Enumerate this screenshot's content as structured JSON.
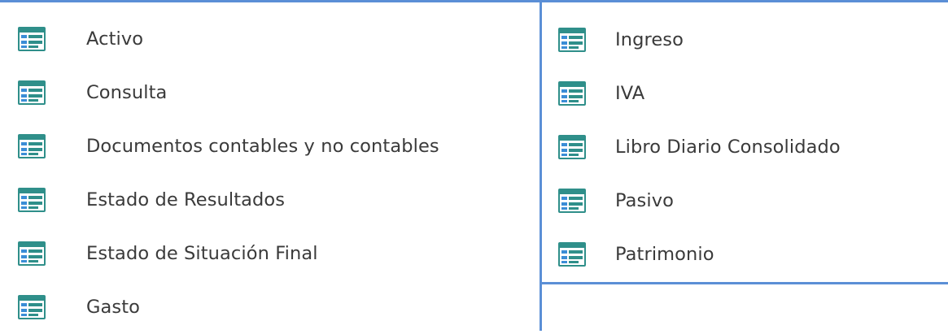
{
  "colors": {
    "border": "#5b8fd6",
    "text": "#3a3a3a",
    "icon_teal": "#2f8f8a",
    "icon_blue": "#4a7fc4"
  },
  "icon_name": "form-icon",
  "left_list": {
    "items": [
      {
        "label": "Activo"
      },
      {
        "label": "Consulta"
      },
      {
        "label": "Documentos contables y no contables"
      },
      {
        "label": "Estado de Resultados"
      },
      {
        "label": "Estado de Situación Final"
      },
      {
        "label": "Gasto"
      }
    ]
  },
  "right_list": {
    "items": [
      {
        "label": "Ingreso"
      },
      {
        "label": "IVA"
      },
      {
        "label": "Libro Diario Consolidado"
      },
      {
        "label": "Pasivo"
      },
      {
        "label": "Patrimonio"
      }
    ]
  }
}
